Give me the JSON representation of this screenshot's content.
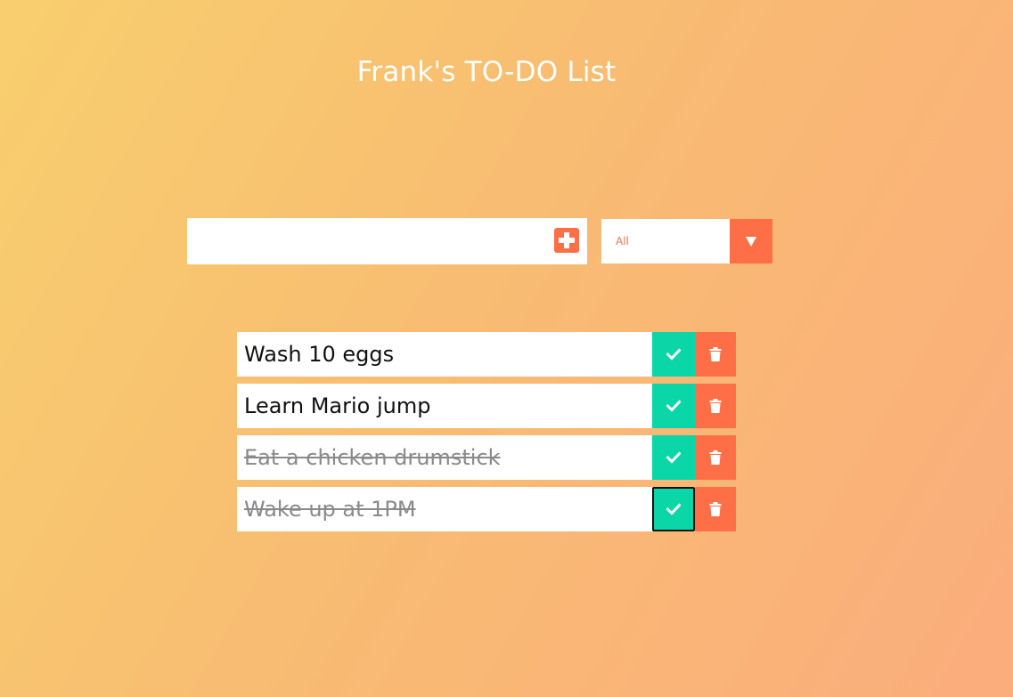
{
  "header": {
    "title": "Frank's TO-DO List"
  },
  "form": {
    "input_value": "",
    "add_icon": "plus-square-icon",
    "filter": {
      "selected": "All",
      "arrow_icon": "caret-down-icon"
    }
  },
  "todos": [
    {
      "text": "Wash 10 eggs",
      "completed": false
    },
    {
      "text": "Learn Mario jump",
      "completed": false
    },
    {
      "text": "Eat a chicken drumstick",
      "completed": true
    },
    {
      "text": "Wake up at 1PM",
      "completed": true
    }
  ],
  "icons": {
    "complete": "check-icon",
    "delete": "trash-icon"
  },
  "colors": {
    "accent": "#ff6f47",
    "complete": "#0bd6a7",
    "background_start": "#f8cf6e",
    "background_end": "#fbad7c",
    "title": "#ffffff"
  }
}
